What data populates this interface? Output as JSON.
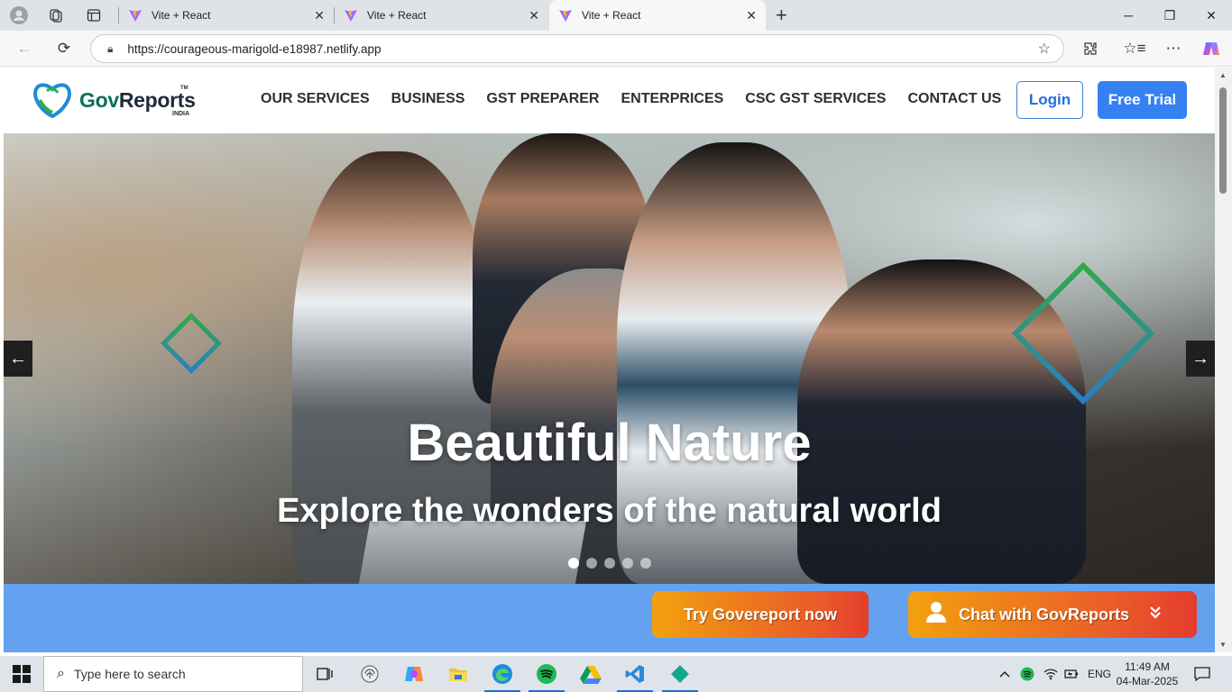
{
  "browser": {
    "tabs": [
      {
        "title": "Vite + React"
      },
      {
        "title": "Vite + React"
      },
      {
        "title": "Vite + React"
      }
    ],
    "url": "https://courageous-marigold-e18987.netlify.app"
  },
  "site": {
    "logo": {
      "brand_gov": "Gov",
      "brand_reports": "Reports",
      "subtitle": "INDIA",
      "tm": "TM"
    },
    "menu": [
      "OUR SERVICES",
      "BUSINESS",
      "GST PREPARER",
      "ENTERPRICES",
      "CSC GST SERVICES",
      "CONTACT US"
    ],
    "login_label": "Login",
    "trial_label": "Free Trial"
  },
  "hero": {
    "title": "Beautiful Nature",
    "subtitle": "Explore the wonders of the natural world",
    "prev_arrow": "←",
    "next_arrow": "→",
    "slide_count": 5,
    "active_slide": 1
  },
  "cta": {
    "try_label": "Try Govereport now",
    "chat_label": "Chat with GovReports"
  },
  "taskbar": {
    "search_placeholder": "Type here to search",
    "language": "ENG",
    "time": "11:49 AM",
    "date": "04-Mar-2025"
  },
  "colors": {
    "primary_blue": "#3580f2",
    "strip_blue": "#64a2f0",
    "cta_orange": "#f2a10f",
    "cta_red": "#e43c2d"
  }
}
